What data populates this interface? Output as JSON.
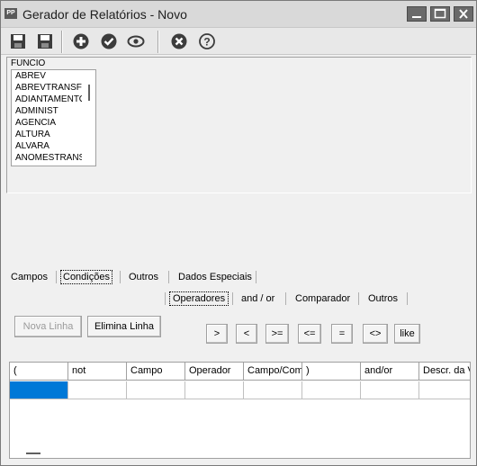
{
  "window": {
    "title": "Gerador de Relatórios - Novo",
    "app_icon_text": "PP"
  },
  "toolbar": {
    "buttons": [
      {
        "name": "save-icon"
      },
      {
        "name": "save-as-icon"
      },
      {
        "name": "add-icon"
      },
      {
        "name": "check-icon"
      },
      {
        "name": "view-icon"
      },
      {
        "name": "cancel-icon"
      },
      {
        "name": "help-icon"
      }
    ]
  },
  "table_panel": {
    "table_name": "FUNCIO",
    "fields": [
      "ABREV",
      "ABREVTRANSF",
      "ADIANTAMENTO",
      "ADMINIST",
      "AGENCIA",
      "ALTURA",
      "ALVARA",
      "ANOMESTRANSF"
    ]
  },
  "main_tabs": {
    "campos": "Campos",
    "condicoes": "Condições",
    "outros": "Outros",
    "dados_especiais": "Dados Especiais"
  },
  "sub_tabs": {
    "operadores": "Operadores",
    "and_or": "and / or",
    "comparador": "Comparador",
    "outros": "Outros"
  },
  "actions": {
    "nova_linha": "Nova Linha",
    "elimina_linha": "Elimina Linha"
  },
  "operators": {
    "gt": ">",
    "lt": "<",
    "gte": ">=",
    "lte": "<=",
    "eq": "=",
    "neq": "<>",
    "like": "like"
  },
  "grid": {
    "columns": {
      "c0": "(",
      "c1": "not",
      "c2": "Campo",
      "c3": "Operador",
      "c4": "Campo/Comparador",
      "c5": ")",
      "c6": "and/or",
      "c7": "Descr. da Variável"
    }
  },
  "colors": {
    "title_bar": "#d9d9d9",
    "selection": "#0078d7",
    "window_bg": "#f0f0f0"
  }
}
